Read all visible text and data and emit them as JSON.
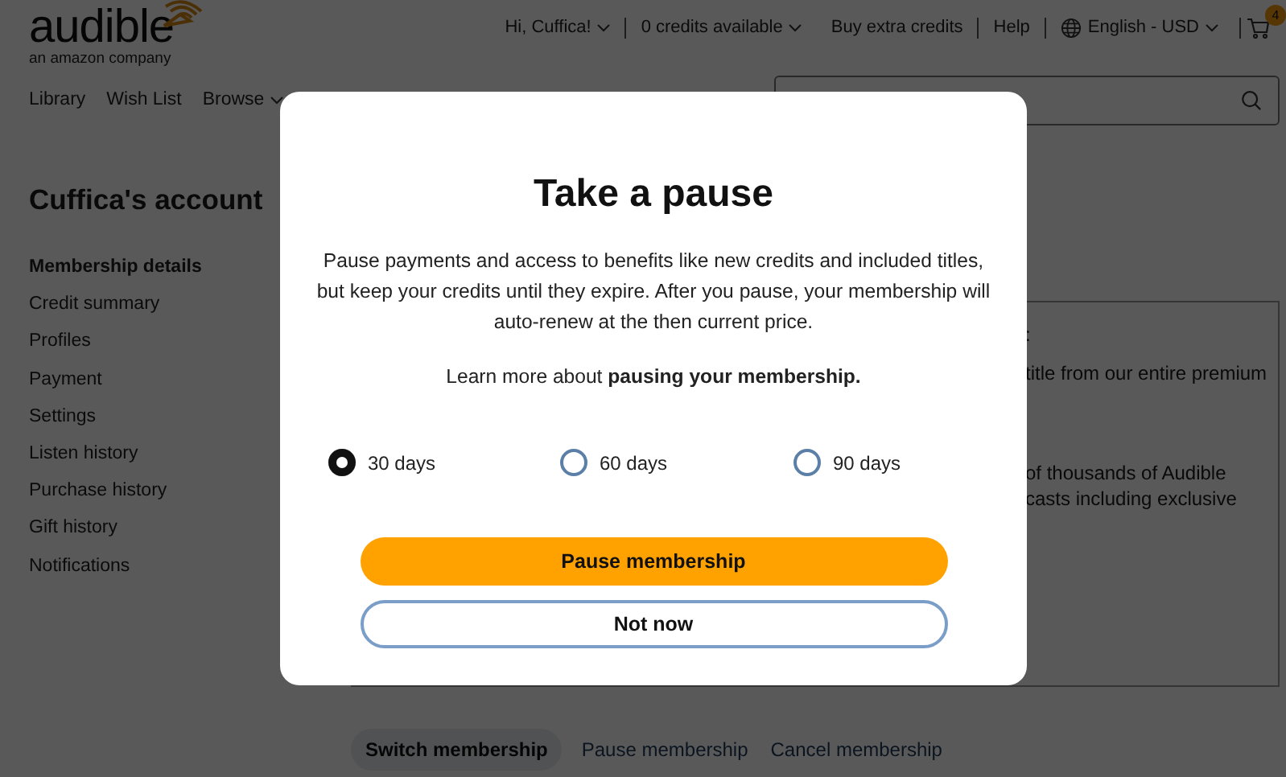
{
  "logo": {
    "name": "audible",
    "tagline": "an amazon company"
  },
  "top_bar": {
    "greeting": "Hi, Cuffica!",
    "credits": "0 credits available",
    "buy_credits": "Buy extra credits",
    "help": "Help",
    "language": "English - USD",
    "cart_count": "4"
  },
  "nav": [
    "Library",
    "Wish List",
    "Browse"
  ],
  "account_title": "Cuffica's account",
  "sidebar": {
    "items": [
      {
        "label": "Membership details",
        "selected": true
      },
      {
        "label": "Credit summary",
        "selected": false
      },
      {
        "label": "Profiles",
        "selected": false
      },
      {
        "label": "Payment",
        "selected": false
      },
      {
        "label": "Settings",
        "selected": false
      },
      {
        "label": "Listen history",
        "selected": false
      },
      {
        "label": "Purchase history",
        "selected": false
      },
      {
        "label": "Gift history",
        "selected": false
      },
      {
        "label": "Notifications",
        "selected": false
      }
    ]
  },
  "membership_panel": {
    "fragments": [
      ":",
      "title from our entire premium",
      "of thousands of Audible",
      "casts including exclusive"
    ]
  },
  "membership_tabs": [
    {
      "label": "Switch membership",
      "selected": true
    },
    {
      "label": "Pause membership",
      "selected": false
    },
    {
      "label": "Cancel membership",
      "selected": false
    }
  ],
  "modal": {
    "title": "Take a pause",
    "body": "Pause payments and access to benefits like new credits and included titles, but keep your credits until they expire. After you pause, your membership will auto-renew at the then current price.",
    "learn_more": "Learn more about **pausing your membership.**",
    "options": [
      {
        "label": "30 days",
        "selected": true
      },
      {
        "label": "60 days",
        "selected": false
      },
      {
        "label": "90 days",
        "selected": false
      }
    ],
    "primary_button": "Pause membership",
    "secondary_button": "Not now"
  }
}
